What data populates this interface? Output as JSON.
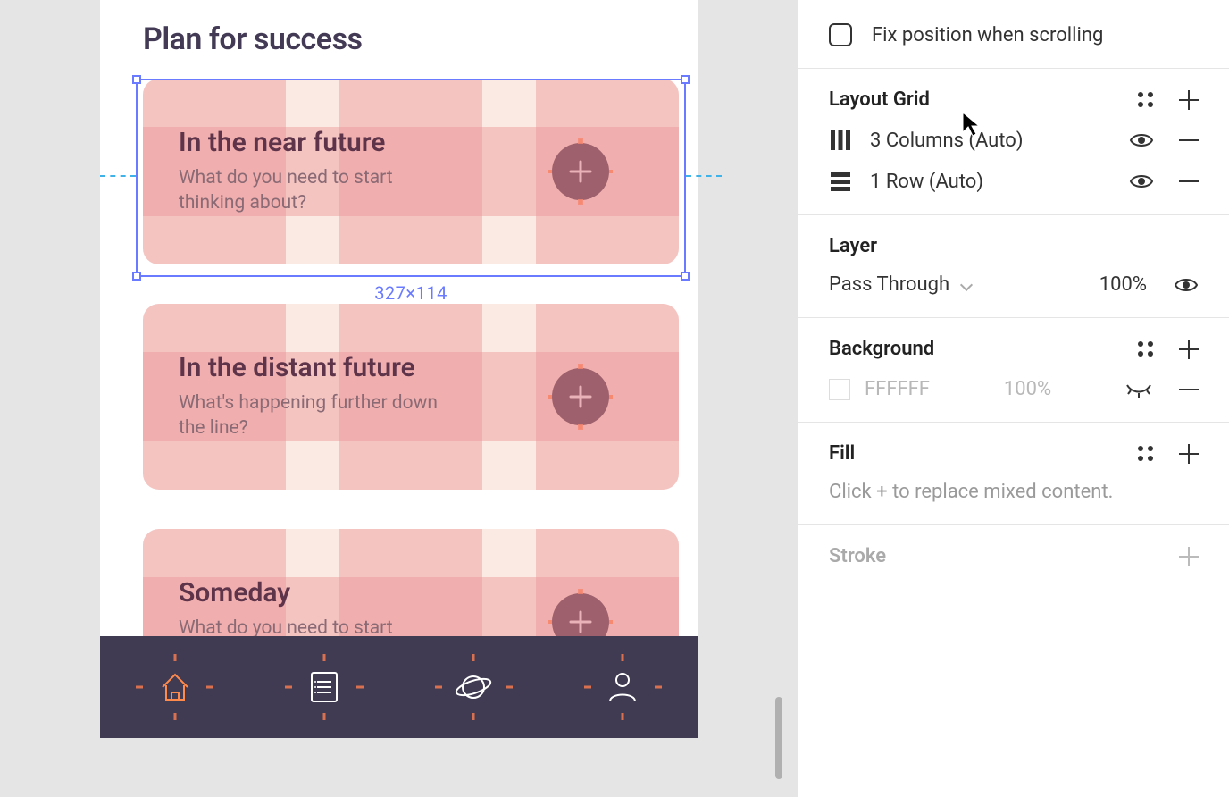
{
  "canvas": {
    "title": "Plan for success",
    "selection_size": "327×114",
    "cards": [
      {
        "title": "In the near future",
        "subtitle": "What do you need to start thinking about?"
      },
      {
        "title": "In the distant future",
        "subtitle": "What's happening further down the line?"
      },
      {
        "title": "Someday",
        "subtitle": "What do you need to start"
      }
    ]
  },
  "panel": {
    "fix_position_label": "Fix position when scrolling",
    "layout_grid": {
      "header": "Layout Grid",
      "items": [
        {
          "label": "3 Columns (Auto)"
        },
        {
          "label": "1 Row (Auto)"
        }
      ]
    },
    "layer": {
      "header": "Layer",
      "blend": "Pass Through",
      "opacity": "100%"
    },
    "background": {
      "header": "Background",
      "hex": "FFFFFF",
      "opacity": "100%"
    },
    "fill": {
      "header": "Fill",
      "hint": "Click + to replace mixed content."
    },
    "stroke": {
      "header": "Stroke"
    }
  }
}
